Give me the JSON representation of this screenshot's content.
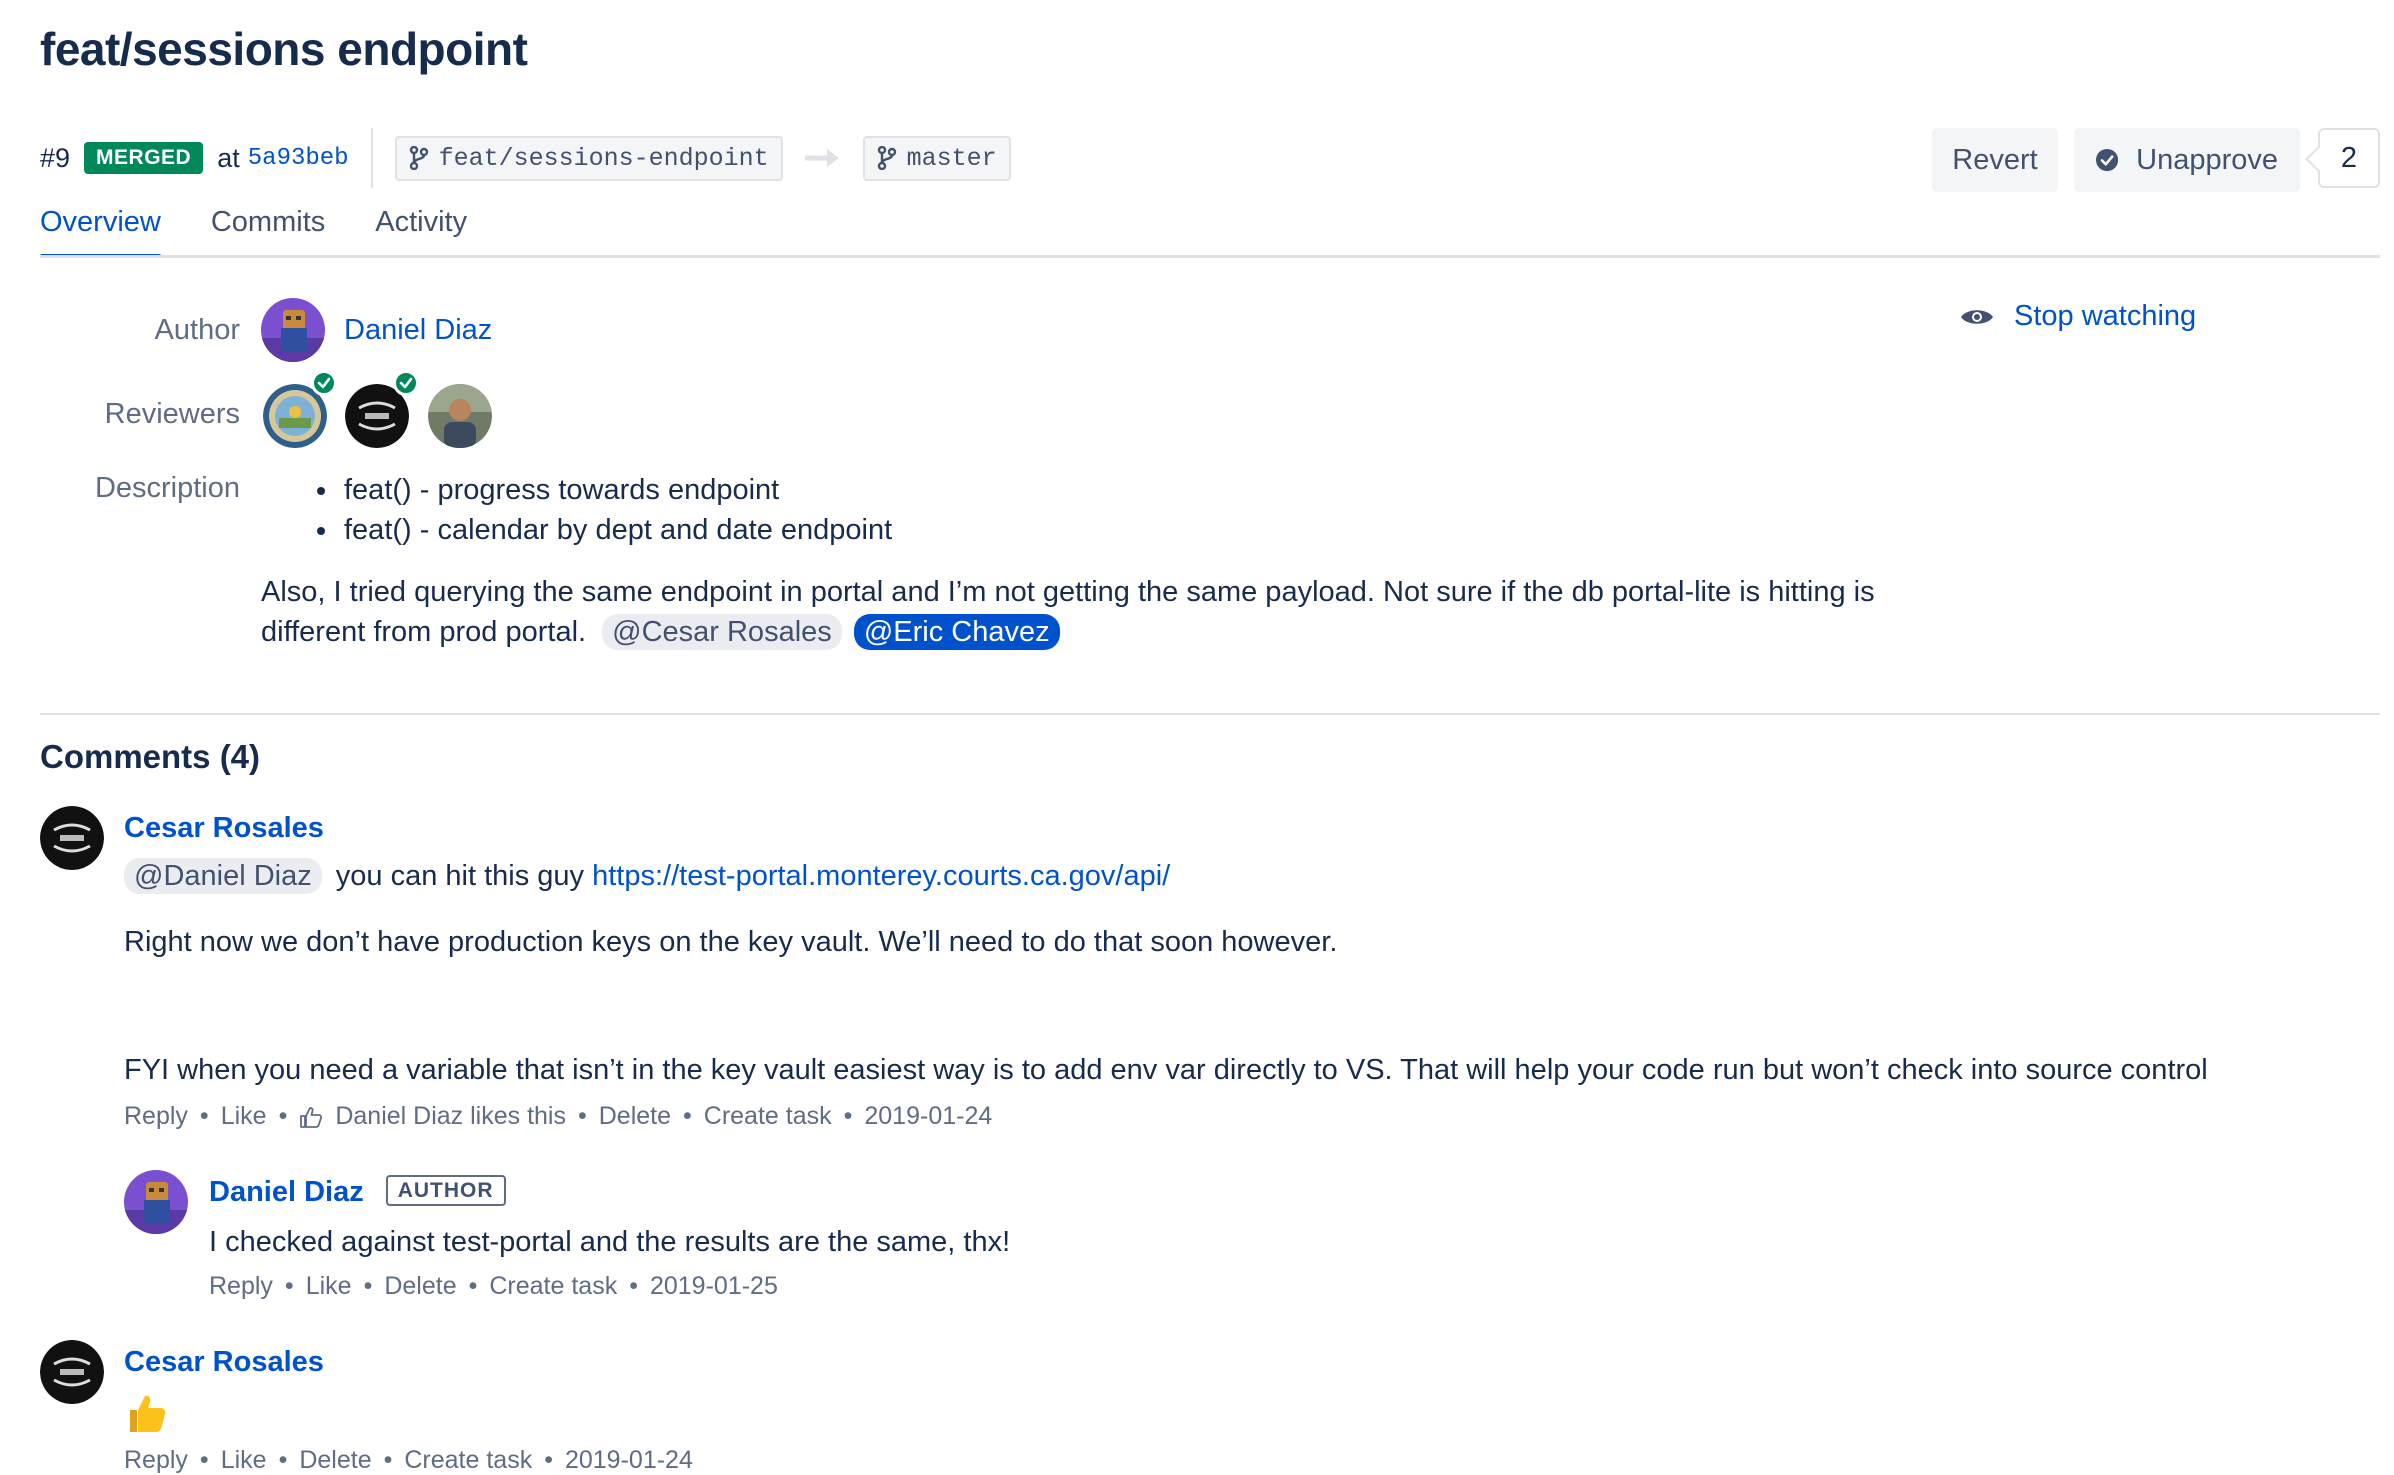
{
  "pr": {
    "title": "feat/sessions endpoint",
    "number": "#9",
    "status": "MERGED",
    "at_label": "at",
    "commit": "5a93beb",
    "source_branch": "feat/sessions-endpoint",
    "target_branch": "master"
  },
  "actions": {
    "revert_label": "Revert",
    "unapprove_label": "Unapprove",
    "approval_count": "2"
  },
  "tabs": [
    {
      "label": "Overview",
      "active": true
    },
    {
      "label": "Commits",
      "active": false
    },
    {
      "label": "Activity",
      "active": false
    }
  ],
  "details": {
    "author_label": "Author",
    "author_name": "Daniel Diaz",
    "reviewers_label": "Reviewers",
    "description_label": "Description",
    "watch_label": "Stop watching",
    "description_items": [
      "feat() - progress towards endpoint",
      "feat() - calendar by dept and date endpoint"
    ],
    "description_text": "Also, I tried querying the same endpoint in portal and I’m not getting the same payload. Not sure if the db portal-lite is hitting is different from prod portal.",
    "mention_1": "@Cesar Rosales",
    "mention_2": "@Eric Chavez"
  },
  "comments_title": "Comments (4)",
  "comments": [
    {
      "author": "Cesar Rosales",
      "mention": "@Daniel Diaz",
      "text_1": "you can hit this guy",
      "link": "https://test-portal.monterey.courts.ca.gov/api/",
      "text_2": "Right now we don’t have production keys on the key vault. We’ll need to do that soon however.",
      "text_3": "FYI when you need a variable that isn’t in the key vault easiest way is to add env var directly to VS. That will help your code run but won’t check into source control",
      "reply": "Reply",
      "like": "Like",
      "likes": "Daniel Diaz likes this",
      "delete": "Delete",
      "create_task": "Create task",
      "date": "2019-01-24"
    },
    {
      "author": "Daniel Diaz",
      "badge": "AUTHOR",
      "text": "I checked against test-portal and the results are the same, thx!",
      "reply": "Reply",
      "like": "Like",
      "delete": "Delete",
      "create_task": "Create task",
      "date": "2019-01-25"
    },
    {
      "author": "Cesar Rosales",
      "reply": "Reply",
      "like": "Like",
      "delete": "Delete",
      "create_task": "Create task",
      "date": "2019-01-24"
    }
  ],
  "colors": {
    "link": "#0052cc",
    "merged": "#00875a",
    "text": "#172b4d",
    "muted": "#5e6c84"
  }
}
